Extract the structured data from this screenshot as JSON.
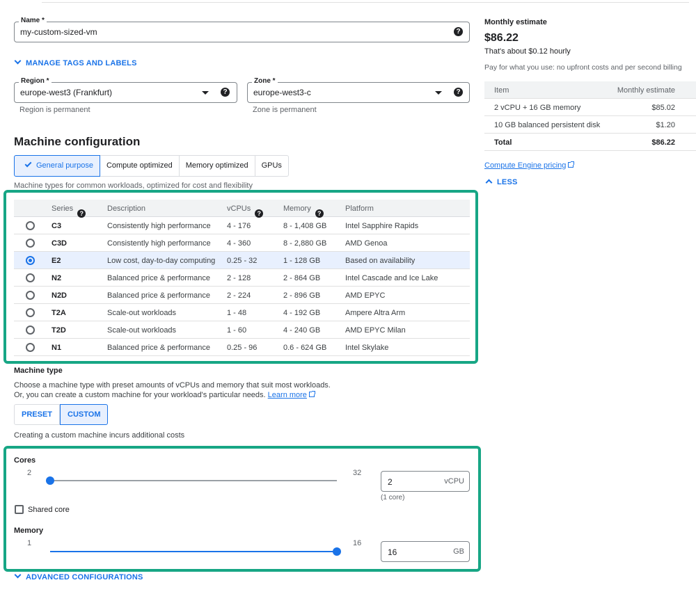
{
  "name_field": {
    "label": "Name *",
    "value": "my-custom-sized-vm"
  },
  "manage_tags": "MANAGE TAGS AND LABELS",
  "region": {
    "label": "Region *",
    "value": "europe-west3 (Frankfurt)",
    "hint": "Region is permanent"
  },
  "zone": {
    "label": "Zone *",
    "value": "europe-west3-c",
    "hint": "Zone is permanent"
  },
  "machine_config": {
    "title": "Machine configuration",
    "tabs": [
      {
        "label": "General purpose",
        "active": true
      },
      {
        "label": "Compute optimized",
        "active": false
      },
      {
        "label": "Memory optimized",
        "active": false
      },
      {
        "label": "GPUs",
        "active": false
      }
    ],
    "subtitle": "Machine types for common workloads, optimized for cost and flexibility",
    "columns": {
      "series": "Series",
      "description": "Description",
      "vcpus": "vCPUs",
      "memory": "Memory",
      "platform": "Platform"
    },
    "rows": [
      {
        "series": "C3",
        "description": "Consistently high performance",
        "vcpus": "4 - 176",
        "memory": "8 - 1,408 GB",
        "platform": "Intel Sapphire Rapids",
        "selected": false
      },
      {
        "series": "C3D",
        "description": "Consistently high performance",
        "vcpus": "4 - 360",
        "memory": "8 - 2,880 GB",
        "platform": "AMD Genoa",
        "selected": false
      },
      {
        "series": "E2",
        "description": "Low cost, day-to-day computing",
        "vcpus": "0.25 - 32",
        "memory": "1 - 128 GB",
        "platform": "Based on availability",
        "selected": true
      },
      {
        "series": "N2",
        "description": "Balanced price & performance",
        "vcpus": "2 - 128",
        "memory": "2 - 864 GB",
        "platform": "Intel Cascade and Ice Lake",
        "selected": false
      },
      {
        "series": "N2D",
        "description": "Balanced price & performance",
        "vcpus": "2 - 224",
        "memory": "2 - 896 GB",
        "platform": "AMD EPYC",
        "selected": false
      },
      {
        "series": "T2A",
        "description": "Scale-out workloads",
        "vcpus": "1 - 48",
        "memory": "4 - 192 GB",
        "platform": "Ampere Altra Arm",
        "selected": false
      },
      {
        "series": "T2D",
        "description": "Scale-out workloads",
        "vcpus": "1 - 60",
        "memory": "4 - 240 GB",
        "platform": "AMD EPYC Milan",
        "selected": false
      },
      {
        "series": "N1",
        "description": "Balanced price & performance",
        "vcpus": "0.25 - 96",
        "memory": "0.6 - 624 GB",
        "platform": "Intel Skylake",
        "selected": false
      }
    ]
  },
  "machine_type": {
    "title": "Machine type",
    "desc_line1": "Choose a machine type with preset amounts of vCPUs and memory that suit most workloads.",
    "desc_line2": "Or, you can create a custom machine for your workload's particular needs.",
    "learn_more": "Learn more",
    "preset_label": "PRESET",
    "custom_label": "CUSTOM",
    "custom_note": "Creating a custom machine incurs additional costs"
  },
  "cores": {
    "label": "Cores",
    "min": "2",
    "max": "32",
    "value": "2",
    "unit": "vCPU",
    "note": "(1 core)",
    "level": 0
  },
  "shared_core": {
    "label": "Shared core",
    "checked": false
  },
  "memory": {
    "label": "Memory",
    "min": "1",
    "max": "16",
    "value": "16",
    "unit": "GB",
    "level": 1
  },
  "advanced": "ADVANCED CONFIGURATIONS",
  "estimate": {
    "title": "Monthly estimate",
    "price": "$86.22",
    "hourly": "That's about $0.12 hourly",
    "note": "Pay for what you use: no upfront costs and per second billing",
    "col_item": "Item",
    "col_cost": "Monthly estimate",
    "items": [
      {
        "item": "2 vCPU + 16 GB memory",
        "cost": "$85.02"
      },
      {
        "item": "10 GB balanced persistent disk",
        "cost": "$1.20"
      }
    ],
    "total_label": "Total",
    "total_value": "$86.22",
    "pricing_link": "Compute Engine pricing",
    "less": "LESS"
  },
  "colors": {
    "accent": "#1a73e8",
    "highlight": "#17a685"
  }
}
